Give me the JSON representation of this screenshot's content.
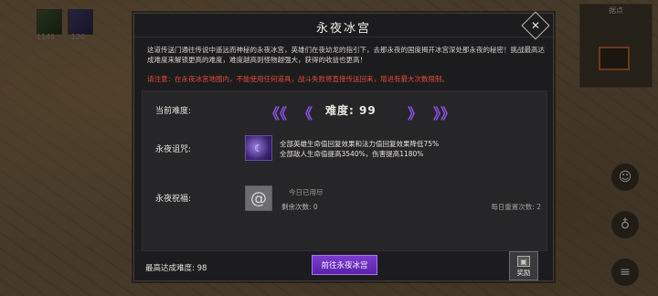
{
  "hud": {
    "slot1_count": "1145",
    "slot2_count": "120",
    "minimap_title": "据点"
  },
  "dialog": {
    "title": "永夜冰宫",
    "description": "这道传送门通往传说中遥远而神秘的永夜冰宫，英雄们在夜幼龙的指引下，去那永夜的国度揭开冰宫深处那永夜的秘密！挑战最高达成难度来解锁更高的难度，难度越高则怪物越强大，获得的收益也更高！",
    "warning": "请注意：在永夜冰宫地图内，不能使用任何道具，战斗失败将直接传送回来，增进有最大次数限制。",
    "difficulty": {
      "label": "当前难度:",
      "left_double": "《《",
      "left_single": "《",
      "value_text": "难度: 99",
      "right_single": "》",
      "right_double": "》》"
    },
    "curse": {
      "label": "永夜诅咒:",
      "icon": "curse-icon",
      "line1": "全部英雄生命值回复效果和法力值回复效果降低75%",
      "line2": "全部敌人生命值提高3540%，伤害提高1180%"
    },
    "blessing": {
      "label": "永夜祝福:",
      "icon": "spiral-icon",
      "status": "今日已用尽",
      "count": "剩余次数: 0",
      "reset": "每日重置次数: 2"
    },
    "max_difficulty": "最高达成难度: 98",
    "go_button": "前往永夜冰宫",
    "reward_label": "奖励"
  },
  "colors": {
    "accent_purple": "#8a4fe0",
    "warning_red": "#e04b3c"
  }
}
